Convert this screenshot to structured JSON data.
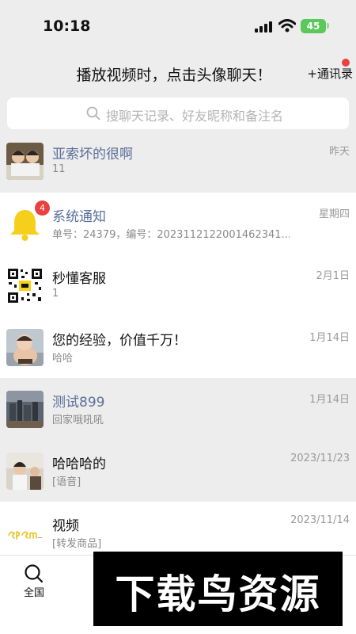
{
  "status_bar": {
    "time": "10:18",
    "battery": "45"
  },
  "header": {
    "title": "播放视频时，点击头像聊天！",
    "contacts_label": "+通讯录"
  },
  "search": {
    "placeholder": "搜聊天记录、好友昵称和备注名"
  },
  "chats": [
    {
      "name": "亚索坏的很啊",
      "preview": "11",
      "time": "昨天",
      "avatar_icon": "photo-avatar",
      "badge": ""
    },
    {
      "name": "系统通知",
      "preview": "单号：24379，编号：2023112122001462341...",
      "time": "星期四",
      "avatar_icon": "bell-icon",
      "badge": "4"
    },
    {
      "name": "秒懂客服",
      "preview": "1",
      "time": "2月1日",
      "avatar_icon": "qr-code-icon",
      "badge": ""
    },
    {
      "name": "您的经验，价值千万！",
      "preview": "哈哈",
      "time": "1月14日",
      "avatar_icon": "photo-avatar",
      "badge": ""
    },
    {
      "name": "测试899",
      "preview": "回家哦吼吼",
      "time": "1月14日",
      "avatar_icon": "photo-avatar",
      "badge": ""
    },
    {
      "name": "哈哈哈的",
      "preview": "[语音]",
      "time": "2023/11/23",
      "avatar_icon": "photo-avatar",
      "badge": ""
    },
    {
      "name": "视频",
      "preview": "[转发商品]",
      "time": "2023/11/14",
      "avatar_icon": "logo-avatar",
      "badge": ""
    }
  ],
  "bottom_nav": {
    "tab_label": "全国"
  },
  "watermark": {
    "text": "下载鸟资源"
  },
  "colors": {
    "accent_blue": "#5a6f99",
    "badge_red": "#e94040",
    "battery_green": "#5ac85a"
  }
}
